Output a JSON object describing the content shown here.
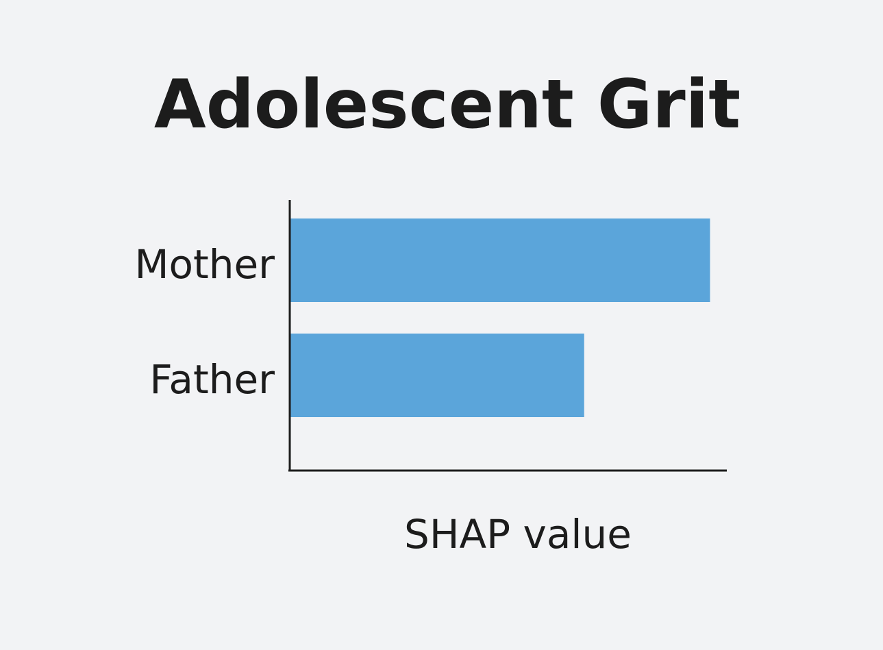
{
  "chart_data": {
    "type": "bar",
    "orientation": "horizontal",
    "title": "Adolescent Grit",
    "categories": [
      "Mother",
      "Father"
    ],
    "values": [
      1.0,
      0.7
    ],
    "xlabel": "SHAP value",
    "ylabel": "",
    "xlim": [
      0,
      1.04
    ],
    "grid": false,
    "legend": "none",
    "bar_color": "#5ba5da"
  }
}
